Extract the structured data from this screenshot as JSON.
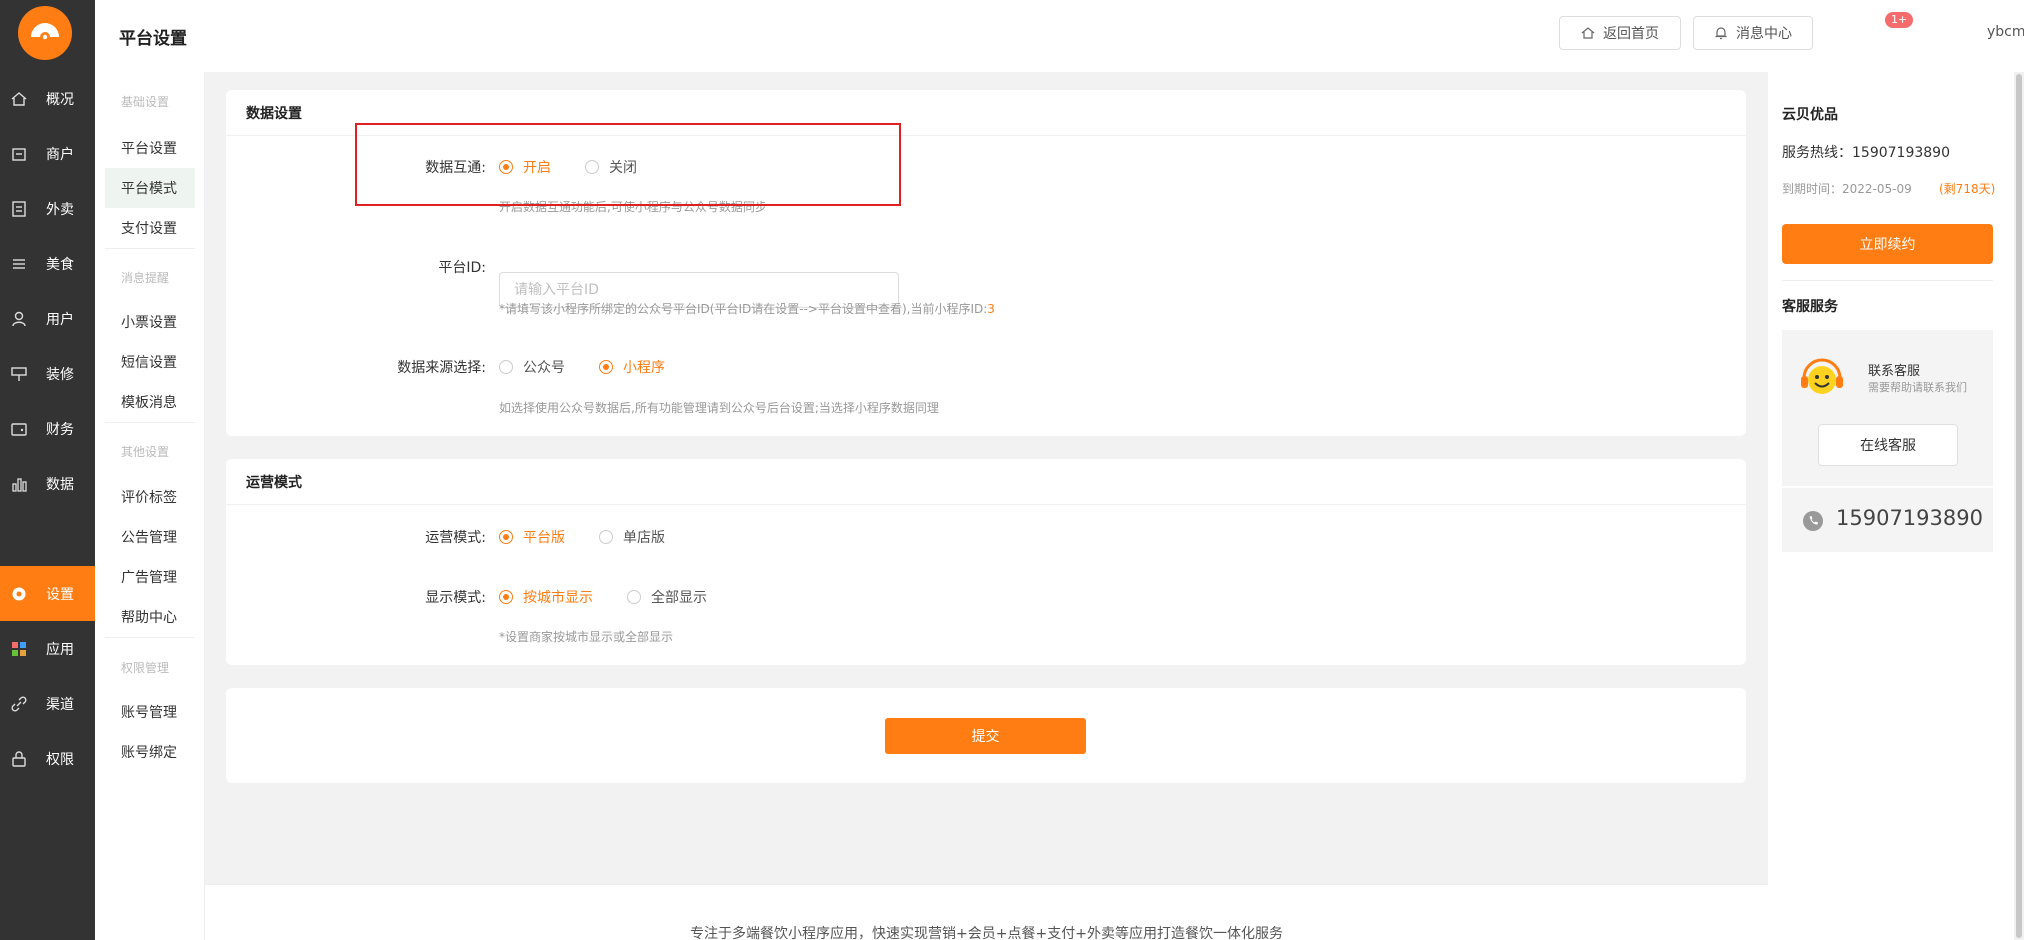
{
  "navbar": {
    "items": [
      {
        "label": "概况",
        "icon": "home-icon"
      },
      {
        "label": "商户",
        "icon": "store-icon"
      },
      {
        "label": "外卖",
        "icon": "document-icon"
      },
      {
        "label": "美食",
        "icon": "list-icon"
      },
      {
        "label": "用户",
        "icon": "user-icon"
      },
      {
        "label": "装修",
        "icon": "decorate-icon"
      },
      {
        "label": "财务",
        "icon": "wallet-icon"
      },
      {
        "label": "数据",
        "icon": "bar-chart-icon"
      },
      {
        "label": "设置",
        "icon": "gear-icon",
        "active": true
      },
      {
        "label": "应用",
        "icon": "apps-icon"
      },
      {
        "label": "渠道",
        "icon": "link-icon"
      },
      {
        "label": "权限",
        "icon": "lock-icon"
      }
    ]
  },
  "subnav": {
    "groups": [
      {
        "title": "基础设置",
        "items": [
          "平台设置",
          "平台模式",
          "支付设置"
        ]
      },
      {
        "title": "消息提醒",
        "items": [
          "小票设置",
          "短信设置",
          "模板消息"
        ]
      },
      {
        "title": "其他设置",
        "items": [
          "评价标签",
          "公告管理",
          "广告管理",
          "帮助中心"
        ]
      },
      {
        "title": "权限管理",
        "items": [
          "账号管理",
          "账号绑定"
        ]
      }
    ],
    "active_item": "平台模式"
  },
  "header": {
    "title": "平台设置",
    "back_home_label": "返回首页",
    "messages_label": "消息中心",
    "messages_badge": "1+",
    "username": "ybcms"
  },
  "data_settings": {
    "title": "数据设置",
    "interop_label": "数据互通:",
    "interop_on": "开启",
    "interop_off": "关闭",
    "interop_hint": "开启数据互通功能后,可使小程序与公众号数据同步",
    "platform_id_label": "平台ID:",
    "platform_id_placeholder": "请输入平台ID",
    "platform_id_value": "",
    "platform_id_hint": "*请填写该小程序所绑定的公众号平台ID(平台ID请在设置-->平台设置中查看),当前小程序ID:",
    "current_miniprogram_id": "3",
    "source_label": "数据来源选择:",
    "source_option_official": "公众号",
    "source_option_mini": "小程序",
    "source_hint": "如选择使用公众号数据后,所有功能管理请到公众号后台设置;当选择小程序数据同理"
  },
  "operation": {
    "title": "运营模式",
    "mode_label": "运营模式:",
    "mode_platform": "平台版",
    "mode_single": "单店版",
    "display_label": "显示模式:",
    "display_city": "按城市显示",
    "display_all": "全部显示",
    "display_hint": "*设置商家按城市显示或全部显示"
  },
  "form": {
    "submit_label": "提交"
  },
  "right_panel": {
    "brand": "云贝优品",
    "hotline": "服务热线：15907193890",
    "expire": "到期时间：2022-05-09",
    "remaining": "(剩718天)",
    "renew_label": "立即续约",
    "cs_title": "客服服务",
    "cs_contact": "联系客服",
    "cs_need_help": "需要帮助请联系我们",
    "cs_online_label": "在线客服",
    "cs_phone": "15907193890"
  },
  "footer": {
    "text": "专注于多端餐饮小程序应用，快速实现营销+会员+点餐+支付+外卖等应用打造餐饮一体化服务"
  },
  "colors": {
    "accent": "#ff7d13",
    "nav_bg": "#333333",
    "highlight_box": "#e02020",
    "subnav_active_bg": "#eef5f1"
  }
}
